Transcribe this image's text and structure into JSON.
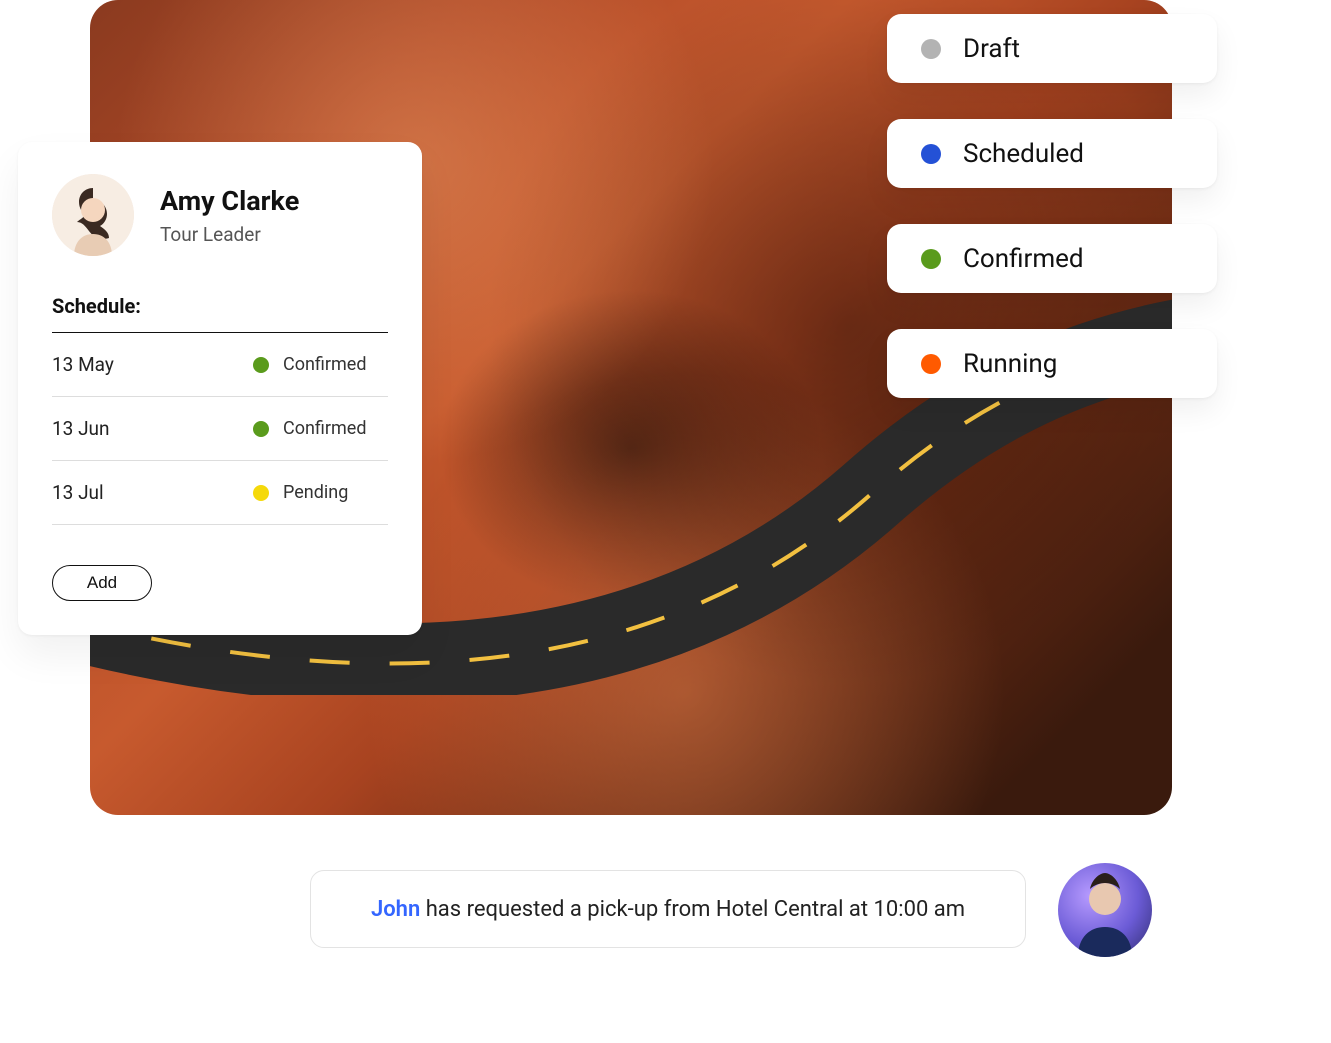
{
  "profile": {
    "name": "Amy Clarke",
    "role": "Tour Leader",
    "schedule_label": "Schedule:",
    "add_button_label": "Add",
    "entries": [
      {
        "date": "13 May",
        "status": "Confirmed",
        "color": "#5a9b1c"
      },
      {
        "date": "13 Jun",
        "status": "Confirmed",
        "color": "#5a9b1c"
      },
      {
        "date": "13 Jul",
        "status": "Pending",
        "color": "#f5d90a"
      }
    ]
  },
  "status_options": [
    {
      "label": "Draft",
      "color": "#b3b3b3"
    },
    {
      "label": "Scheduled",
      "color": "#2451d6"
    },
    {
      "label": "Confirmed",
      "color": "#5a9b1c"
    },
    {
      "label": "Running",
      "color": "#ff5a00"
    }
  ],
  "notification": {
    "highlighted_name": "John",
    "rest": " has requested a pick-up from Hotel Central at 10:00 am"
  }
}
